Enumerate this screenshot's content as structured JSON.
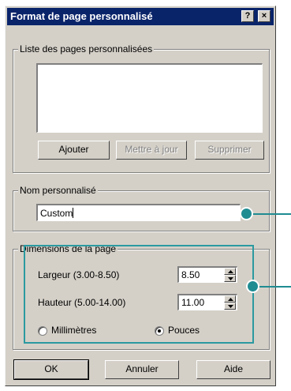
{
  "window": {
    "title": "Format de page personnalisé",
    "help_label": "?",
    "close_label": "×"
  },
  "custom_pages": {
    "legend": "Liste des pages personnalisées",
    "items": [],
    "add_label": "Ajouter",
    "update_label": "Mettre à jour",
    "delete_label": "Supprimer"
  },
  "custom_name": {
    "legend": "Nom personnalisé",
    "value": "Custom"
  },
  "dimensions": {
    "legend": "Dimensions de la page",
    "width_label": "Largeur (3.00-8.50)",
    "width_value": "8.50",
    "height_label": "Hauteur (5.00-14.00)",
    "height_value": "11.00",
    "units": [
      {
        "label": "Millimètres",
        "selected": false
      },
      {
        "label": "Pouces",
        "selected": true
      }
    ]
  },
  "footer": {
    "ok_label": "OK",
    "cancel_label": "Annuler",
    "help_label": "Aide"
  },
  "colors": {
    "title_bar": "#0a246a",
    "dialog_face": "#d4d0c8",
    "callout": "#1f8c92"
  }
}
